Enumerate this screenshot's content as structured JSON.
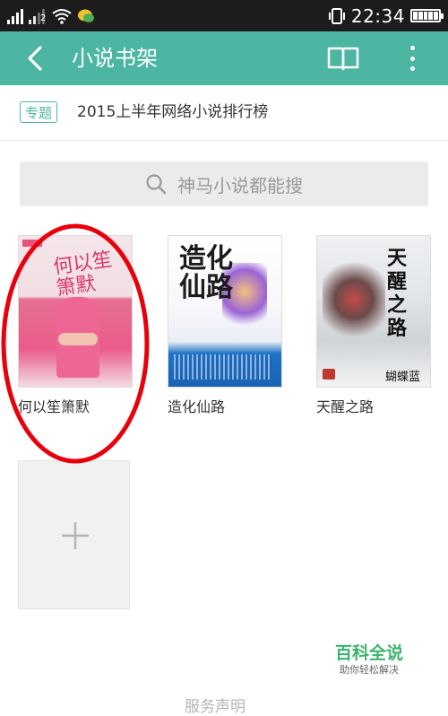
{
  "status_bar": {
    "time": "22:34",
    "signal_label": "2",
    "icons": [
      "signal-icon",
      "wifi-icon",
      "chat-app-icon",
      "vibrate-icon",
      "battery-icon"
    ]
  },
  "toolbar": {
    "title": "小说书架",
    "background": "#4cb6a3",
    "icons": [
      "back-arrow-icon",
      "open-book-icon",
      "more-vert-icon"
    ]
  },
  "topic": {
    "badge": "专题",
    "text": "2015上半年网络小说排行榜"
  },
  "search": {
    "placeholder": "神马小说都能搜"
  },
  "books": [
    {
      "title": "何以笙箫默",
      "cover_title": "何以笙箫默",
      "highlighted": true
    },
    {
      "title": "造化仙路",
      "cover_title": "造化仙路"
    },
    {
      "title": "天醒之路",
      "cover_title": "天醒之路",
      "cover_author": "蝴蝶蓝"
    }
  ],
  "add_tile": {
    "icon": "plus-icon"
  },
  "annotation": {
    "color": "#e8000c",
    "shape": "ellipse"
  },
  "watermark": {
    "main": "百科全说",
    "sub": "助你轻松解决"
  },
  "footer": {
    "text": "服务声明"
  }
}
